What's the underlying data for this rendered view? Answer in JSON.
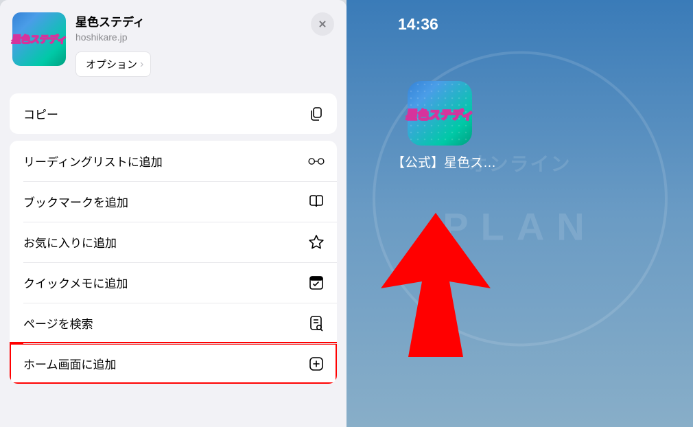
{
  "left": {
    "app_title": "星色ステディ",
    "app_url": "hoshikare.jp",
    "options_label": "オプション",
    "logo_text": "星色ステディ",
    "copy_label": "コピー",
    "menu": [
      {
        "label": "リーディングリストに追加",
        "icon": "glasses"
      },
      {
        "label": "ブックマークを追加",
        "icon": "book"
      },
      {
        "label": "お気に入りに追加",
        "icon": "star"
      },
      {
        "label": "クイックメモに追加",
        "icon": "note"
      },
      {
        "label": "ページを検索",
        "icon": "find"
      },
      {
        "label": "ホーム画面に追加",
        "icon": "plus",
        "highlighted": true
      }
    ]
  },
  "right": {
    "time": "14:36",
    "app_label": "【公式】星色ス…",
    "logo_text": "星色ステディ",
    "watermark_top": "オンライン",
    "watermark_text": "PLAN"
  }
}
